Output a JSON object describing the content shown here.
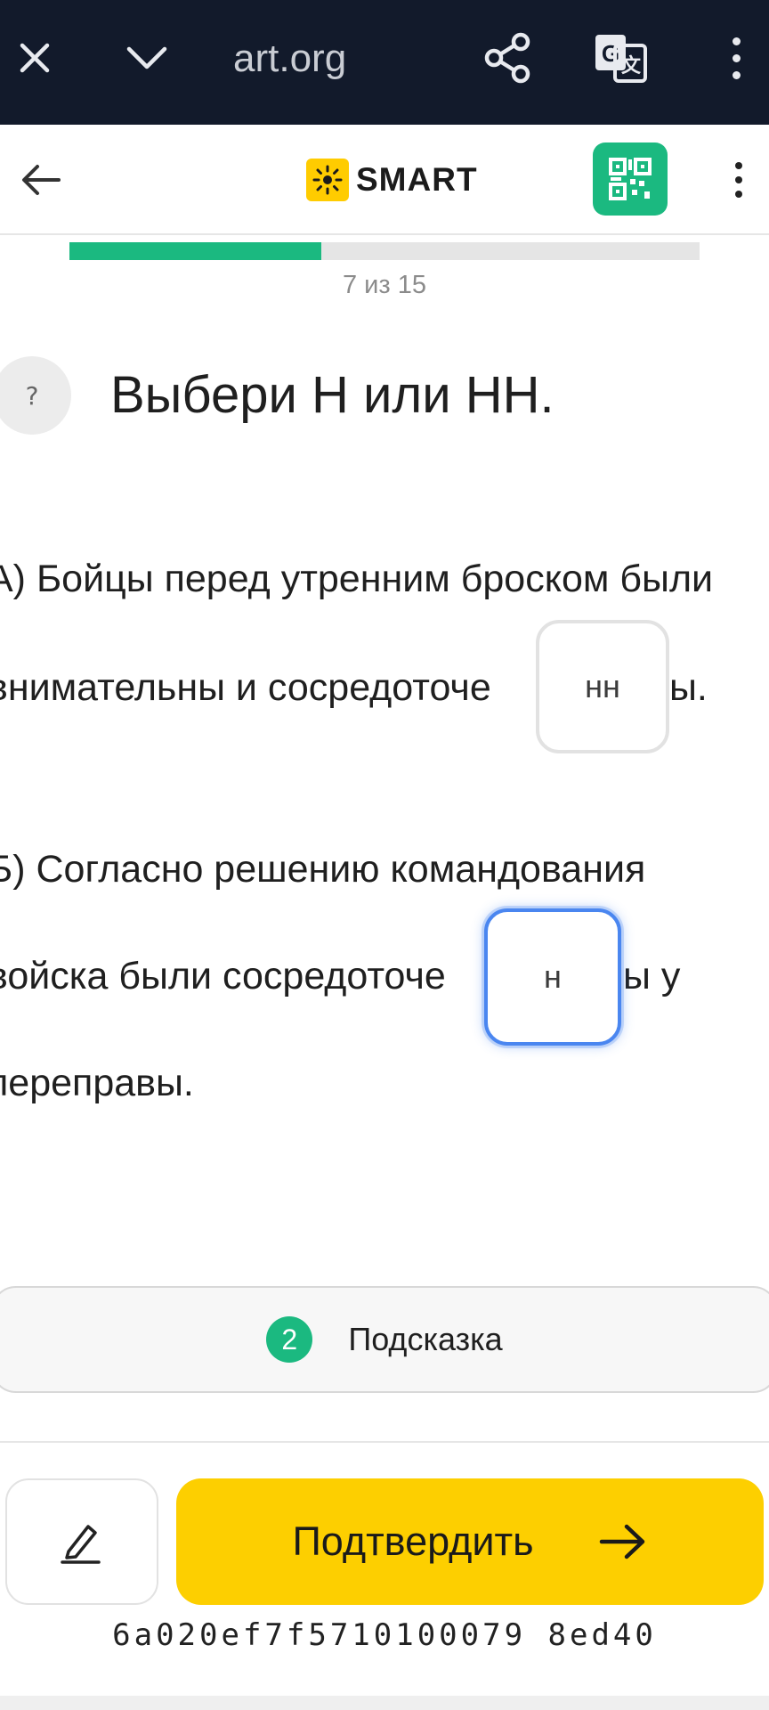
{
  "browser": {
    "url_fragment": "art.org",
    "close_icon": "close-icon",
    "chevron_icon": "chevron-down-icon",
    "share_icon": "share-icon",
    "translate_icon": "translate-icon",
    "menu_icon": "more-vertical-icon"
  },
  "header": {
    "logo_text": "SMART",
    "brand_color": "#ffcc00",
    "qr_color": "#1bb980"
  },
  "progress": {
    "text": "7 из 15",
    "current": 7,
    "total": 15,
    "fill_fraction": 0.4,
    "color": "#1bb980"
  },
  "question": {
    "help_symbol": "?",
    "title": "Выбери Н или НН."
  },
  "sentence_a": {
    "line1": "А) Бойцы перед утренним броском были",
    "line2_before": "внимательны и сосредоточе",
    "line2_after": "ы.",
    "answer": "нн"
  },
  "sentence_b": {
    "line1": "Б) Согласно решению командования",
    "line2_before": "войска были сосредоточе",
    "line2_after": "ы у",
    "line3": "переправы.",
    "answer": "н"
  },
  "hint": {
    "count": "2",
    "label": "Подсказка"
  },
  "actions": {
    "edit_icon": "pencil-icon",
    "confirm_label": "Подтвердить",
    "confirm_icon": "arrow-right-icon",
    "confirm_color": "#fdcf00"
  },
  "footer": {
    "hash": "6a020ef7f5710100079 8ed40"
  }
}
